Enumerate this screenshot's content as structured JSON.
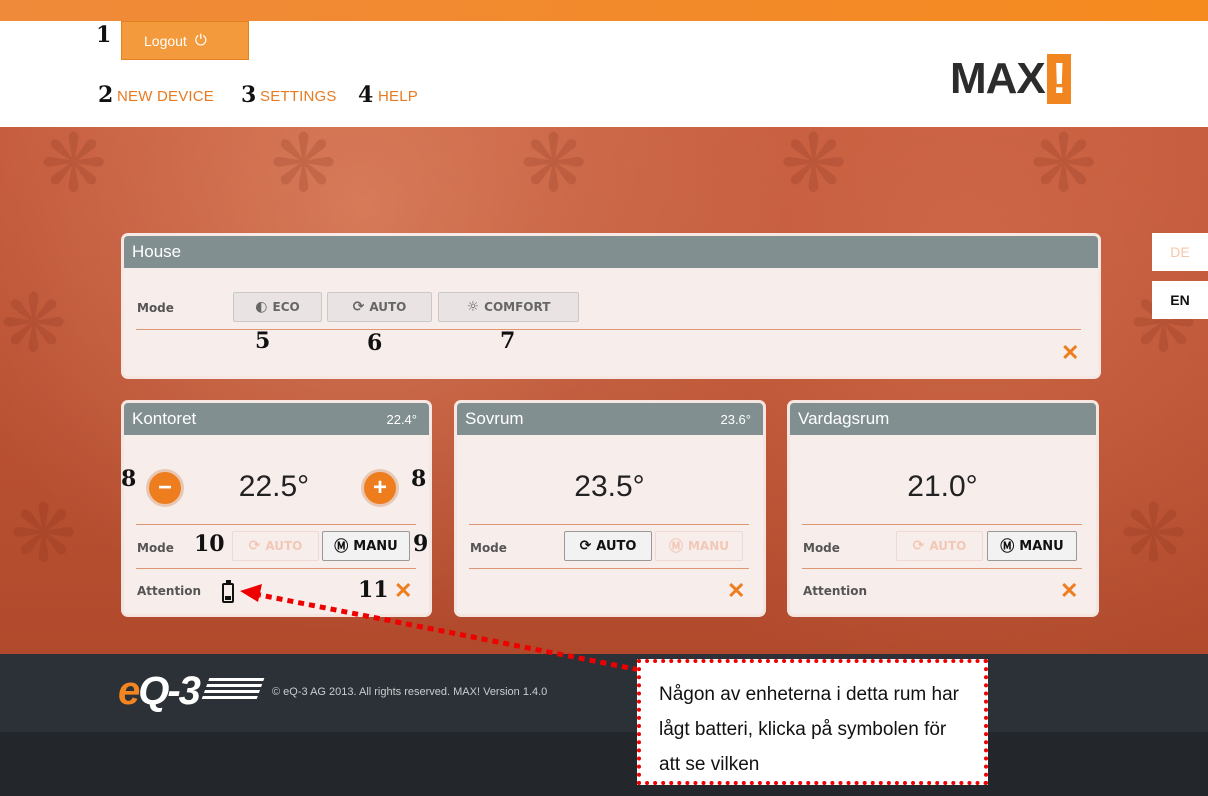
{
  "header": {
    "logout_label": "Logout",
    "logout_icon": "power-icon",
    "nav": {
      "new_device": "NEW DEVICE",
      "settings": "SETTINGS",
      "help": "HELP"
    },
    "logo": "MAX",
    "logo_mark": "!"
  },
  "annotations": {
    "n1": "1",
    "n2": "2",
    "n3": "3",
    "n4": "4",
    "n5": "5",
    "n6": "6",
    "n7": "7",
    "n8a": "8",
    "n8b": "8",
    "n9": "9",
    "n10": "10",
    "n11": "11"
  },
  "house": {
    "title": "House",
    "mode_label": "Mode",
    "eco": "ECO",
    "auto": "AUTO",
    "comfort": "COMFORT"
  },
  "rooms": [
    {
      "name": "Kontoret",
      "current": "22.4°",
      "target": "22.5°",
      "mode_label": "Mode",
      "auto": "AUTO",
      "manu": "MANU",
      "active_mode": "MANU",
      "attention_label": "Attention"
    },
    {
      "name": "Sovrum",
      "current": "23.6°",
      "target": "23.5°",
      "mode_label": "Mode",
      "auto": "AUTO",
      "manu": "MANU",
      "active_mode": "AUTO"
    },
    {
      "name": "Vardagsrum",
      "target": "21.0°",
      "mode_label": "Mode",
      "auto": "AUTO",
      "manu": "MANU",
      "active_mode": "MANU",
      "attention_label": "Attention"
    }
  ],
  "languages": {
    "de": "DE",
    "en": "EN",
    "active": "EN"
  },
  "footer": {
    "brand_e": "e",
    "brand_rest": "Q-3",
    "copyright": "© eQ-3 AG 2013. All rights reserved. MAX! Version 1.4.0"
  },
  "callout": {
    "text": "Någon av enheterna i detta rum har lågt batteri, klicka på symbolen för att se vilken"
  },
  "colors": {
    "accent": "#ee7d1e",
    "header_bar": "#828f91",
    "footer": "#2c3137",
    "callout_border": "#e00000"
  }
}
